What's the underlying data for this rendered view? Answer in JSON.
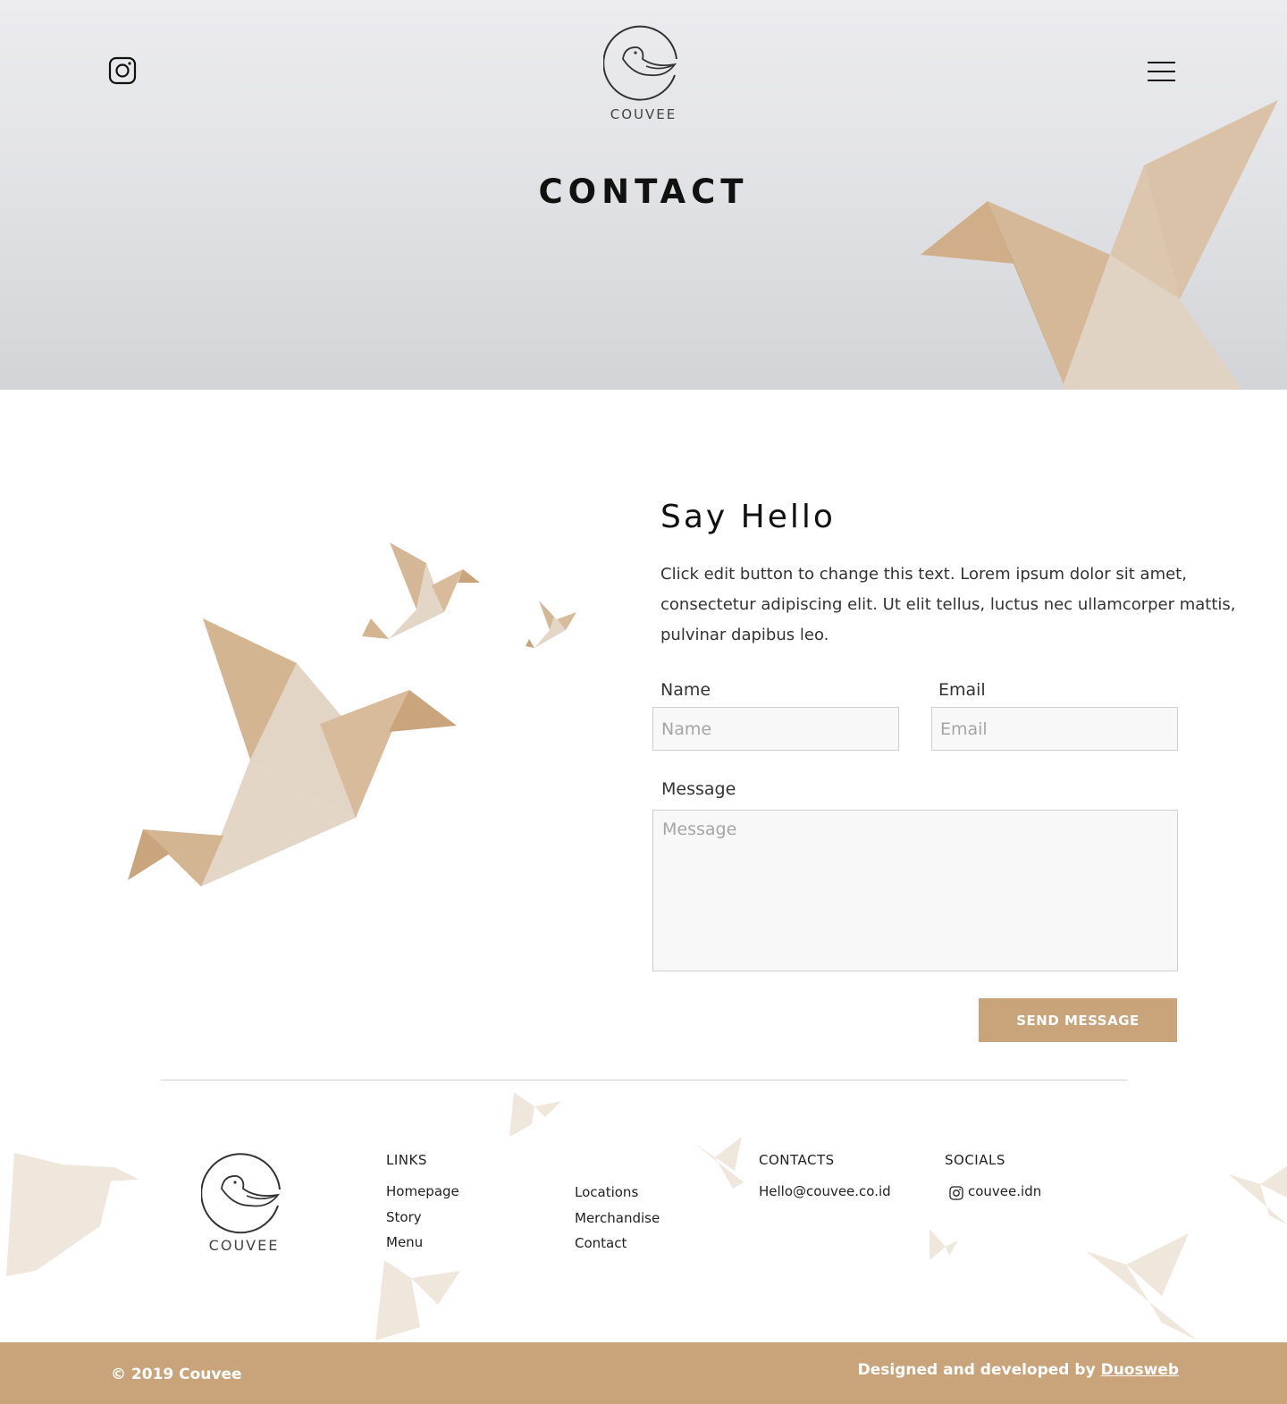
{
  "header": {
    "title": "CONTACT",
    "brand": "COUVEE",
    "instagram_icon": "instagram-icon",
    "menu_icon": "hamburger-menu-icon"
  },
  "contact": {
    "heading": "Say Hello",
    "intro": "Click edit button to change this text. Lorem ipsum dolor sit amet, consectetur adipiscing elit. Ut elit tellus, luctus nec ullamcorper mattis, pulvinar dapibus leo.",
    "name_label": "Name",
    "name_placeholder": "Name",
    "email_label": "Email",
    "email_placeholder": "Email",
    "message_label": "Message",
    "message_placeholder": "Message",
    "send_label": "SEND MESSAGE"
  },
  "footer": {
    "brand": "COUVEE",
    "links_heading": "LINKS",
    "links_col1": [
      "Homepage",
      "Story",
      "Menu"
    ],
    "links_col2": [
      "Locations",
      "Merchandise",
      "Contact"
    ],
    "contacts_heading": "CONTACTS",
    "contact_email": "Hello@couvee.co.id",
    "socials_heading": "SOCIALS",
    "instagram_handle": "couvee.idn",
    "copyright": "© 2019 Couvee",
    "credit_prefix": "Designed and developed by",
    "credit_link": "Duosweb"
  },
  "colors": {
    "accent": "#c9a47b",
    "bird_dark": "#cba883",
    "bird_mid": "#d8bd9e",
    "bird_light": "#e4d6c6"
  }
}
